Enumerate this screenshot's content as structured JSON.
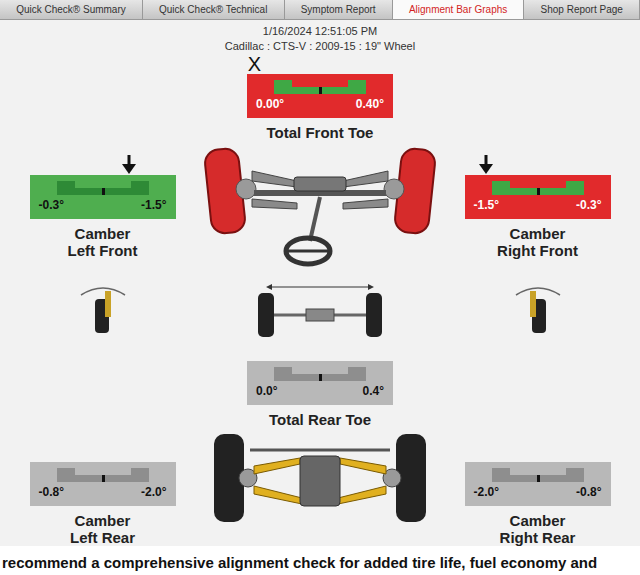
{
  "tabs": [
    {
      "label": "Quick Check® Summary",
      "selected": false
    },
    {
      "label": "Quick Check® Technical",
      "selected": false
    },
    {
      "label": "Symptom Report",
      "selected": false
    },
    {
      "label": "Alignment Bar Graphs",
      "selected": true
    },
    {
      "label": "Shop Report Page",
      "selected": false
    }
  ],
  "header": {
    "timestamp": "1/16/2024 12:51:05 PM",
    "vehicle": "Cadillac : CTS-V : 2009-15 : 19\" Wheel"
  },
  "front_toe": {
    "label_lines": [
      "Total Front Toe"
    ],
    "min": "0.00°",
    "max": "0.40°",
    "status": "out",
    "marker": "x",
    "marker_text": "X",
    "level": 0.05
  },
  "left_front_camber": {
    "label_lines": [
      "Camber",
      "Left Front"
    ],
    "min": "-0.3°",
    "max": "-1.5°",
    "status": "in",
    "marker": "arrow",
    "level": 0.68
  },
  "right_front_camber": {
    "label_lines": [
      "Camber",
      "Right Front"
    ],
    "min": "-1.5°",
    "max": "-0.3°",
    "status": "out",
    "marker": "arrow",
    "level": 0.15
  },
  "rear_toe": {
    "label_lines": [
      "Total Rear Toe"
    ],
    "min": "0.0°",
    "max": "0.4°",
    "status": "unmeasured",
    "marker": "none"
  },
  "left_rear_camber": {
    "label_lines": [
      "Camber",
      "Left Rear"
    ],
    "min": "-0.8°",
    "max": "-2.0°",
    "status": "unmeasured",
    "marker": "none"
  },
  "right_rear_camber": {
    "label_lines": [
      "Camber",
      "Right Rear"
    ],
    "min": "-2.0°",
    "max": "-0.8°",
    "status": "unmeasured",
    "marker": "none"
  },
  "footer": {
    "text": "recommend a comprehensive alignment check for added tire life, fuel economy and"
  }
}
